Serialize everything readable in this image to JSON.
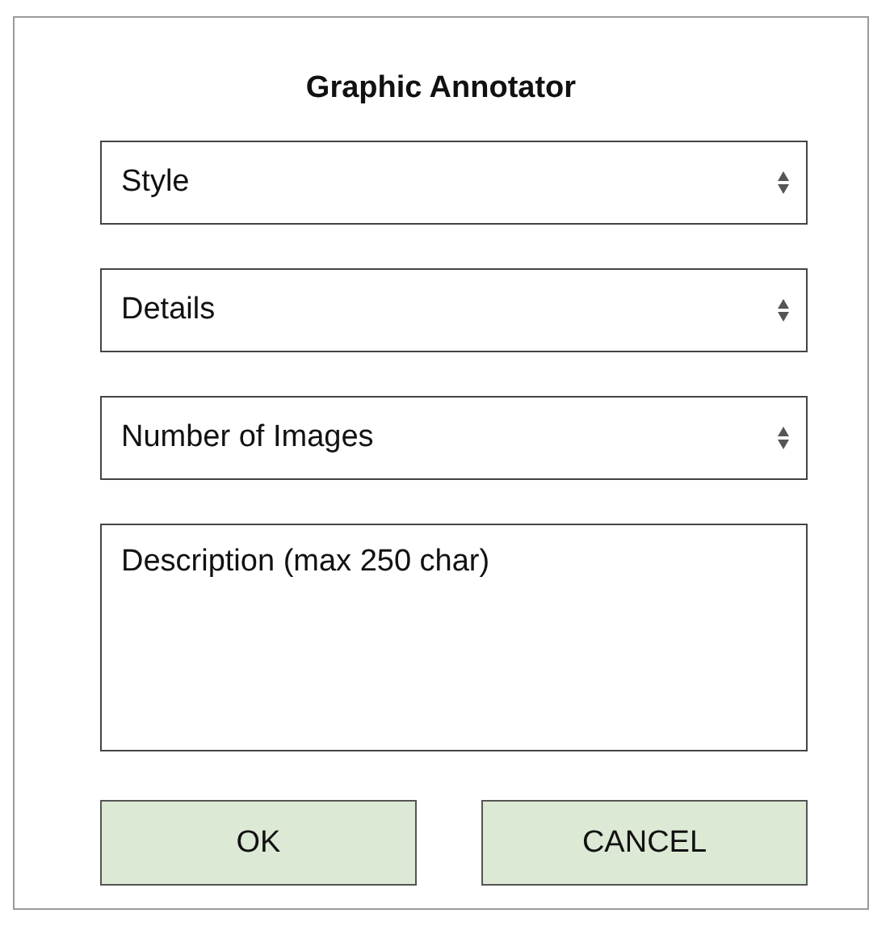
{
  "dialog": {
    "title": "Graphic Annotator"
  },
  "selects": [
    {
      "placeholder": "Style"
    },
    {
      "placeholder": "Details"
    },
    {
      "placeholder": "Number of Images"
    }
  ],
  "description": {
    "placeholder": "Description (max 250 char)"
  },
  "buttons": [
    {
      "label": "OK"
    },
    {
      "label": "CANCEL"
    }
  ]
}
